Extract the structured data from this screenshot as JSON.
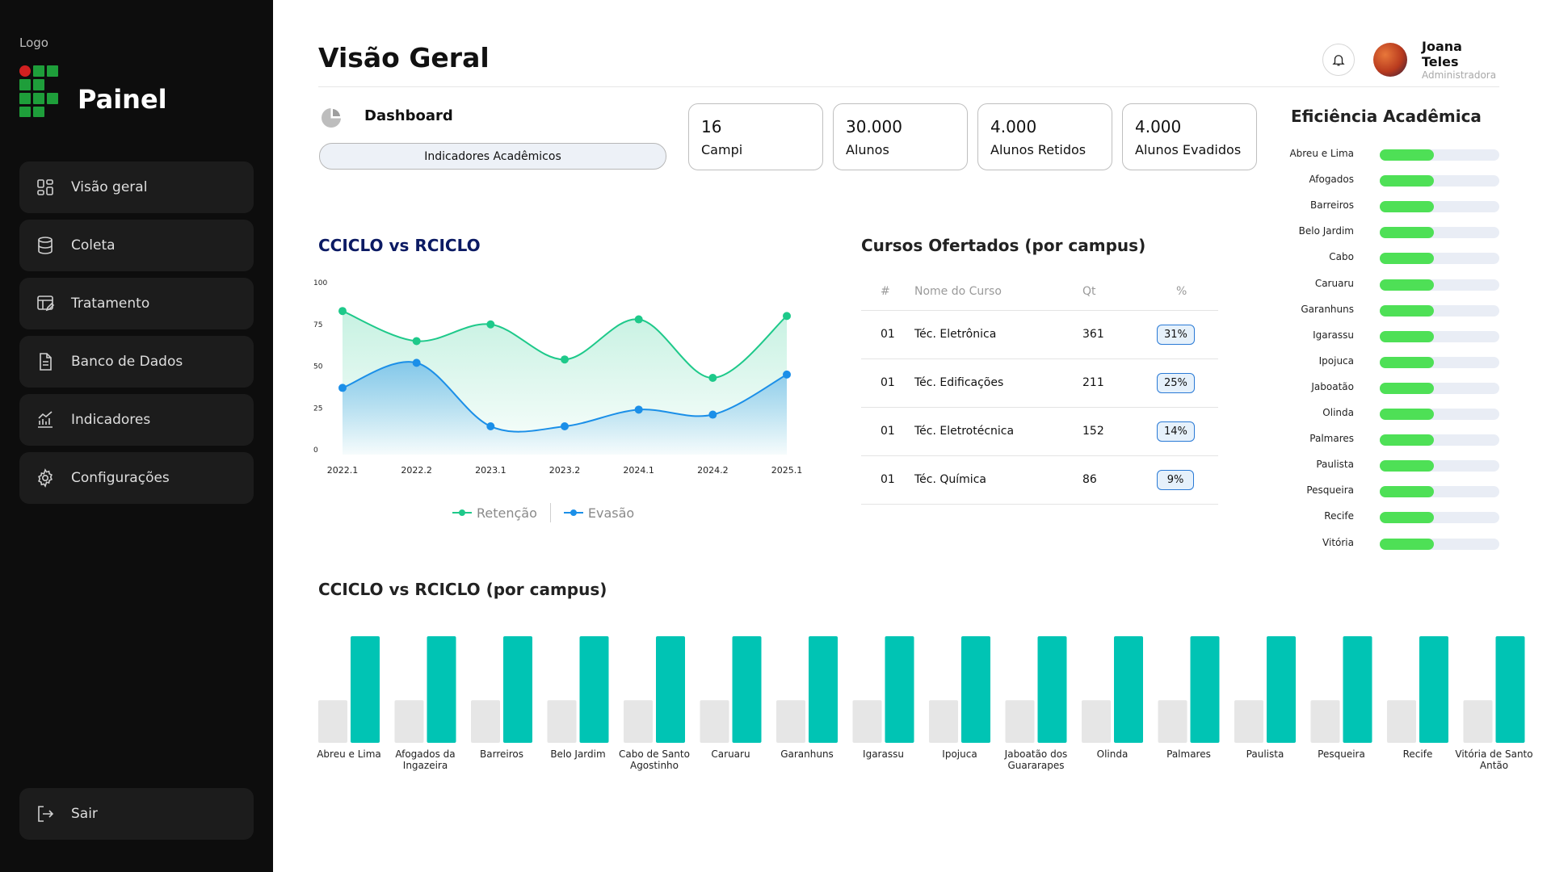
{
  "sidebar": {
    "logo_caption": "Logo",
    "brand": "Painel",
    "items": [
      {
        "label": "Visão geral",
        "icon": "grid-icon"
      },
      {
        "label": "Coleta",
        "icon": "database-icon"
      },
      {
        "label": "Tratamento",
        "icon": "edit-table-icon"
      },
      {
        "label": "Banco de Dados",
        "icon": "document-icon"
      },
      {
        "label": "Indicadores",
        "icon": "chart-icon"
      },
      {
        "label": "Configurações",
        "icon": "gear-icon"
      }
    ],
    "logout": {
      "label": "Sair",
      "icon": "logout-icon"
    }
  },
  "header": {
    "title": "Visão Geral",
    "user": {
      "name": "Joana Teles",
      "role": "Administradora"
    }
  },
  "dashboard": {
    "title": "Dashboard",
    "pill": "Indicadores Acadêmicos"
  },
  "stats": [
    {
      "value": "16",
      "label": "Campi"
    },
    {
      "value": "30.000",
      "label": "Alunos"
    },
    {
      "value": "4.000",
      "label": "Alunos Retidos"
    },
    {
      "value": "4.000",
      "label": "Alunos Evadidos"
    }
  ],
  "colors": {
    "retencao": "#1ec98a",
    "evasao": "#1b8fe8",
    "bar_primary": "#00c4b4",
    "bar_secondary": "#e6e6e6",
    "efficiency": "#4ee056",
    "sidebar_bg": "#0d0d0d"
  },
  "line_chart": {
    "title": "CCICLO vs RCICLO",
    "legend": [
      "Retenção",
      "Evasão"
    ],
    "chart_data": {
      "type": "line",
      "x": [
        "2022.1",
        "2022.2",
        "2023.1",
        "2023.2",
        "2024.1",
        "2024.2",
        "2025.1"
      ],
      "yticks": [
        0,
        25,
        50,
        75,
        100
      ],
      "ylim": [
        0,
        100
      ],
      "series": [
        {
          "name": "Retenção",
          "values": [
            83,
            65,
            75,
            54,
            78,
            43,
            80
          ]
        },
        {
          "name": "Evasão",
          "values": [
            37,
            52,
            14,
            14,
            24,
            21,
            45
          ]
        }
      ]
    }
  },
  "courses": {
    "title": "Cursos Ofertados (por campus)",
    "columns": [
      "#",
      "Nome do Curso",
      "Qt",
      "%"
    ],
    "rows": [
      {
        "id": "01",
        "name": "Téc. Eletrônica",
        "qt": "361",
        "pct": "31%"
      },
      {
        "id": "01",
        "name": "Téc. Edificações",
        "qt": "211",
        "pct": "25%"
      },
      {
        "id": "01",
        "name": "Téc. Eletrotécnica",
        "qt": "152",
        "pct": "14%"
      },
      {
        "id": "01",
        "name": "Téc. Química",
        "qt": "86",
        "pct": "9%"
      }
    ]
  },
  "efficiency": {
    "title": "Eficiência Acadêmica",
    "items": [
      {
        "campus": "Abreu e Lima",
        "value": 0.45
      },
      {
        "campus": "Afogados",
        "value": 0.45
      },
      {
        "campus": "Barreiros",
        "value": 0.45
      },
      {
        "campus": "Belo Jardim",
        "value": 0.45
      },
      {
        "campus": "Cabo",
        "value": 0.45
      },
      {
        "campus": "Caruaru",
        "value": 0.45
      },
      {
        "campus": "Garanhuns",
        "value": 0.45
      },
      {
        "campus": "Igarassu",
        "value": 0.45
      },
      {
        "campus": "Ipojuca",
        "value": 0.45
      },
      {
        "campus": "Jaboatão",
        "value": 0.45
      },
      {
        "campus": "Olinda",
        "value": 0.45
      },
      {
        "campus": "Palmares",
        "value": 0.45
      },
      {
        "campus": "Paulista",
        "value": 0.45
      },
      {
        "campus": "Pesqueira",
        "value": 0.45
      },
      {
        "campus": "Recife",
        "value": 0.45
      },
      {
        "campus": "Vitória",
        "value": 0.45
      }
    ]
  },
  "bar_chart": {
    "title": "CCICLO vs RCICLO (por campus)",
    "chart_data": {
      "type": "bar",
      "categories": [
        "Abreu e Lima",
        "Afogados da Ingazeira",
        "Barreiros",
        "Belo Jardim",
        "Cabo de Santo Agostinho",
        "Caruaru",
        "Garanhuns",
        "Igarassu",
        "Ipojuca",
        "Jaboatão dos Guararapes",
        "Olinda",
        "Palmares",
        "Paulista",
        "Pesqueira",
        "Recife",
        "Vitória de Santo Antão"
      ],
      "series": [
        {
          "values": [
            40,
            40,
            40,
            40,
            40,
            40,
            40,
            40,
            40,
            40,
            40,
            40,
            40,
            40,
            40,
            40
          ]
        },
        {
          "values": [
            100,
            100,
            100,
            100,
            100,
            100,
            100,
            100,
            100,
            100,
            100,
            100,
            100,
            100,
            100,
            100
          ]
        }
      ],
      "ylim": [
        0,
        100
      ]
    }
  }
}
